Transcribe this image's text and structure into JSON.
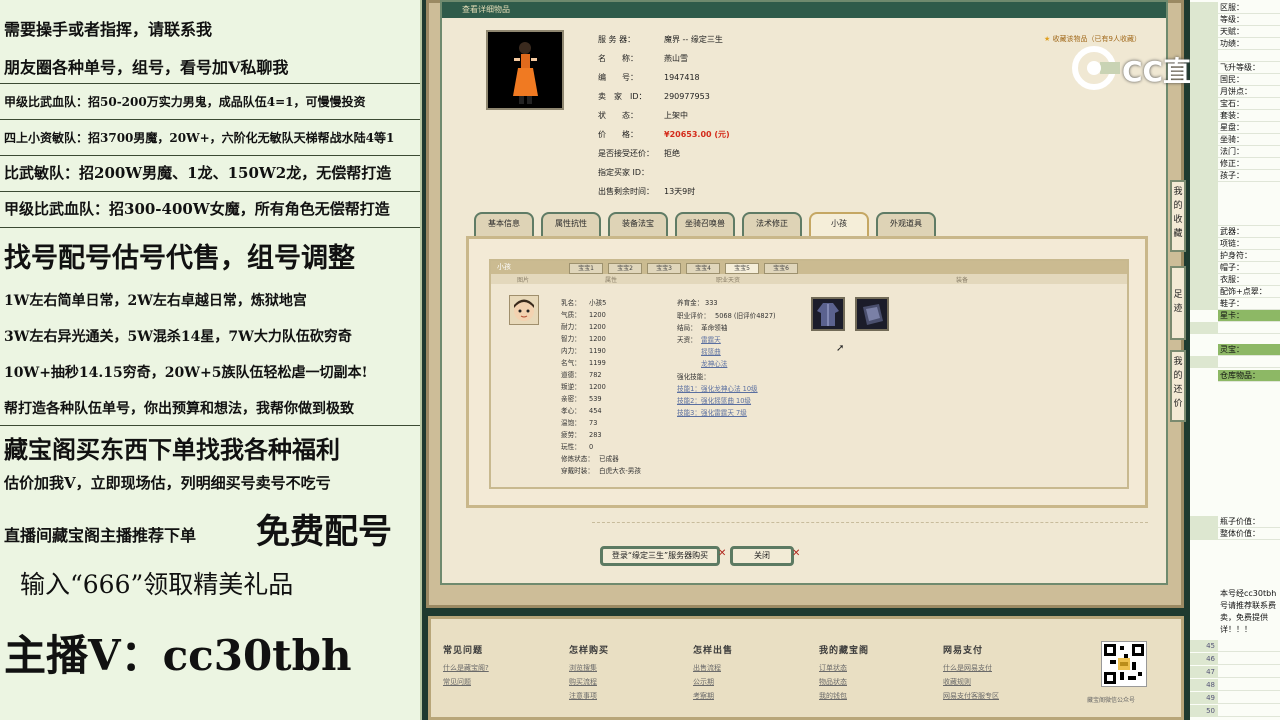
{
  "left_panel": {
    "lines": [
      "需要操手或者指挥，请联系我",
      "朋友圈各种单号，组号，看号加V私聊我",
      "甲级比武血队：招50-200万实力男鬼，成品队伍4=1，可慢慢投资",
      "四上小资敏队：招3700男魔，20W+，六阶化无敏队天梯帮战水陆4等1",
      "比武敏队：招200W男魔、1龙、150W2龙，无偿帮打造",
      "甲级比武血队：招300-400W女魔，所有角色无偿帮打造",
      "找号配号估号代售，组号调整",
      "1W左右简单日常，2W左右卓越日常，炼狱地宫",
      "3W左右异光通关，5W混杀14星，7W大力队伍砍穷奇",
      "10W+抽秒14.15穷奇，20W+5族队伍轻松虐一切副本!",
      "帮打造各种队伍单号，你出预算和想法，我帮你做到极致",
      "藏宝阁买东西下单找我各种福利",
      "估价加我V，立即现场估，列明细买号卖号不吃亏",
      "直播间藏宝阁主播推荐下单",
      "免费配号",
      "输入“666”领取精美礼品",
      "主播V：cc30tbh"
    ]
  },
  "window": {
    "title": "查看详细物品",
    "fav_link": "收藏该物品（已有9人收藏）",
    "details": [
      {
        "k": "服 务 器：",
        "v": "魔界 -- 缘定三生"
      },
      {
        "k": "名　　称：",
        "v": "燕山雪"
      },
      {
        "k": "编　　号：",
        "v": "1947418"
      },
      {
        "k": "卖　家　ID：",
        "v": "290977953"
      },
      {
        "k": "状　　态：",
        "v": "上架中"
      },
      {
        "k": "价　　格：",
        "v": "¥20653.00 (元)"
      },
      {
        "k": "是否接受还价：",
        "v": "拒绝"
      },
      {
        "k": "指定买家 ID：",
        "v": ""
      },
      {
        "k": "出售剩余时间：",
        "v": "13天9时"
      }
    ],
    "price_color": "#d42b1b",
    "tabs": [
      "基本信息",
      "属性抗性",
      "装备法宝",
      "坐骑召唤兽",
      "法术修正",
      "小孩",
      "外观道具"
    ],
    "active_tab": "小孩",
    "panel_title": "小孩",
    "subtabs": [
      "宝宝1",
      "宝宝2",
      "宝宝3",
      "宝宝4",
      "宝宝5",
      "宝宝6"
    ],
    "active_subtab": "宝宝5",
    "columns": [
      "图片",
      "属性",
      "职业天资",
      "装备"
    ],
    "pet_stats": [
      {
        "k": "乳名：",
        "v": "小孩5"
      },
      {
        "k": "气质：",
        "v": "1200"
      },
      {
        "k": "耐力：",
        "v": "1200"
      },
      {
        "k": "智力：",
        "v": "1200"
      },
      {
        "k": "内力：",
        "v": "1190"
      },
      {
        "k": "名气：",
        "v": "1199"
      },
      {
        "k": "道德：",
        "v": "782"
      },
      {
        "k": "叛逆：",
        "v": "1200"
      },
      {
        "k": "亲密：",
        "v": "539"
      },
      {
        "k": "孝心：",
        "v": "454"
      },
      {
        "k": "温饱：",
        "v": "73"
      },
      {
        "k": "疲劳：",
        "v": "283"
      },
      {
        "k": "玩性：",
        "v": "0"
      },
      {
        "k": "修炼状态：",
        "v": "已成器"
      },
      {
        "k": "穿戴时装：",
        "v": "白虎大衣-男孩"
      }
    ],
    "pet_info": [
      {
        "k": "养育金：",
        "v": "333"
      },
      {
        "k": "职业评价：",
        "v": "5068 (旧评价4827)"
      },
      {
        "k": "结局：",
        "v": "革命领袖"
      },
      {
        "k": "天资：",
        "v": "雷霆天"
      }
    ],
    "talents_extra": [
      "摇篮曲",
      "龙神心法"
    ],
    "strengthen_title": "强化技能：",
    "strengthen": [
      "技能1：强化龙神心法 10级",
      "技能2：强化摇篮曲 10级",
      "技能3：强化雷霆天 7级"
    ],
    "buttons": {
      "login": "登录“缘定三生”服务器购买",
      "close": "关闭"
    }
  },
  "footer": {
    "columns": [
      {
        "title": "常见问题",
        "links": [
          "什么是藏宝阁?",
          "常见问题"
        ]
      },
      {
        "title": "怎样购买",
        "links": [
          "浏览搜集",
          "购买流程",
          "注意事项"
        ]
      },
      {
        "title": "怎样出售",
        "links": [
          "出售流程",
          "公示期",
          "考察期"
        ]
      },
      {
        "title": "我的藏宝阁",
        "links": [
          "订单状态",
          "物品状态",
          "我的钱包"
        ]
      },
      {
        "title": "网易支付",
        "links": [
          "什么是网易支付",
          "收藏规则",
          "网易支付客服专区"
        ]
      }
    ],
    "qr_caption": "藏宝阁微信公众号"
  },
  "logo": {
    "text": "CC直播"
  },
  "side_tabs": [
    "我的收藏",
    "足迹",
    "我的还价"
  ],
  "sheet": {
    "top_rows": [
      {
        "n": "",
        "t": "区服："
      },
      {
        "n": "",
        "t": "等级："
      },
      {
        "n": "",
        "t": "天赋："
      },
      {
        "n": "",
        "t": "功绩："
      },
      {
        "n": "",
        "t": ""
      },
      {
        "n": "",
        "t": "飞升等级："
      },
      {
        "n": "",
        "t": "国民："
      },
      {
        "n": "",
        "t": "月饼点："
      },
      {
        "n": "",
        "t": "宝石："
      },
      {
        "n": "",
        "t": "套装："
      },
      {
        "n": "",
        "t": "星盘："
      },
      {
        "n": "",
        "t": "坐骑："
      },
      {
        "n": "",
        "t": "法门："
      },
      {
        "n": "",
        "t": "修正："
      },
      {
        "n": "",
        "t": "孩子："
      }
    ],
    "mid_rows": [
      "武器：",
      "项链：",
      "护身符：",
      "帽子：",
      "衣服：",
      "配饰+点翠：",
      "鞋子：",
      "星卡：",
      "",
      "灵宝：",
      "",
      "仓库物品："
    ],
    "mid_green": [
      7,
      9,
      11
    ],
    "bottom_rows": [
      "瓶子价值：",
      "整体价值："
    ],
    "note": "本号经cc30tbh号请推荐联系费卖，免费提供详！！！",
    "row_numbers": [
      "45",
      "46",
      "47",
      "48",
      "49",
      "50"
    ]
  }
}
